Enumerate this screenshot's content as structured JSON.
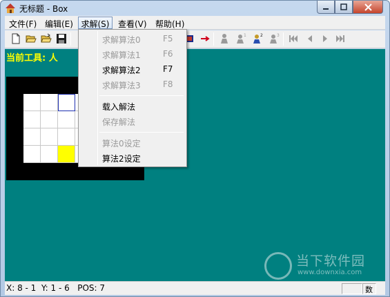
{
  "window": {
    "title": "无标题 - Box"
  },
  "menubar": {
    "file": "文件(F)",
    "edit": "编辑(E)",
    "solve": "求解(S)",
    "view": "查看(V)",
    "help": "帮助(H)"
  },
  "solve_menu": {
    "items": [
      {
        "label": "求解算法0",
        "shortcut": "F5",
        "enabled": false
      },
      {
        "label": "求解算法1",
        "shortcut": "F6",
        "enabled": false
      },
      {
        "label": "求解算法2",
        "shortcut": "F7",
        "enabled": true
      },
      {
        "label": "求解算法3",
        "shortcut": "F8",
        "enabled": false
      },
      {
        "label": "载入解法",
        "enabled": true
      },
      {
        "label": "保存解法",
        "enabled": false
      },
      {
        "label": "算法0设定",
        "enabled": false
      },
      {
        "label": "算法2设定",
        "enabled": true
      }
    ]
  },
  "toolbar": {
    "icons": [
      "new-file-icon",
      "open-folder-icon",
      "open-folder-alt-icon",
      "save-icon",
      "arrow-right-icon",
      "figure-icon",
      "figure-1-icon",
      "figure-2-icon",
      "figure-3-icon",
      "skip-back-icon",
      "step-back-icon",
      "step-forward-icon",
      "skip-forward-icon"
    ]
  },
  "client": {
    "current_tool": "当前工具: 人",
    "background_color": "#008080",
    "board": {
      "rows": 4,
      "cols": 4,
      "selected_cell": [
        0,
        2
      ],
      "yellow_cell": [
        3,
        2
      ]
    }
  },
  "watermark": {
    "main": "当下软件园",
    "url": "www.downxia.com"
  },
  "statusbar": {
    "text": "X: 8 - 1  Y: 1 - 6   POS: 7",
    "indicator": "数"
  }
}
